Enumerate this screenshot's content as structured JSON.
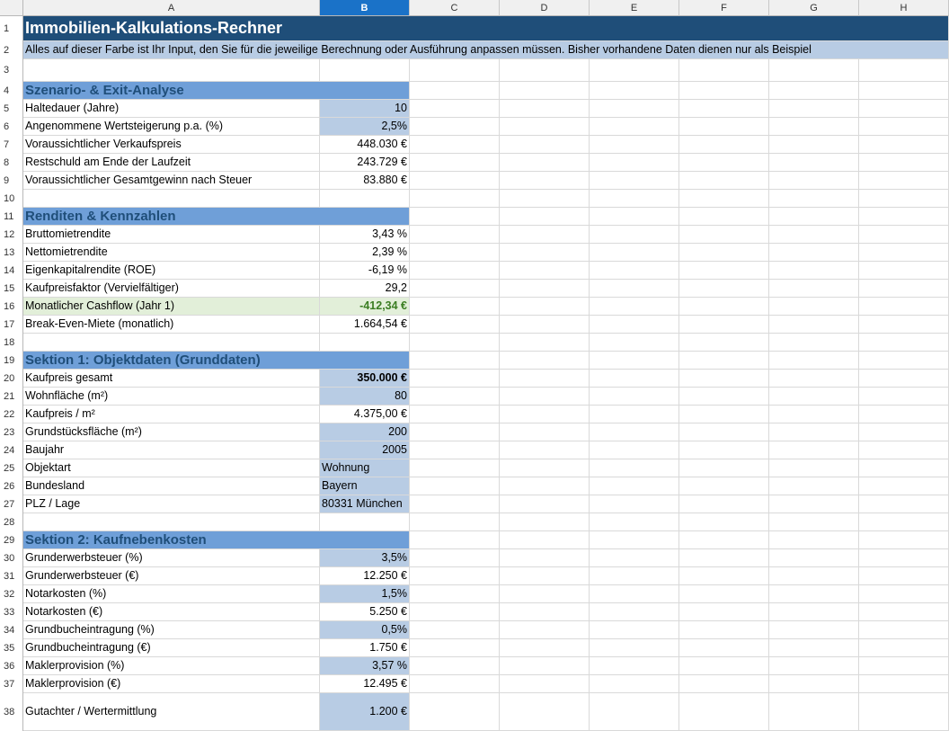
{
  "columns": [
    "A",
    "B",
    "C",
    "D",
    "E",
    "F",
    "G",
    "H"
  ],
  "selected_column": "B",
  "row_numbers": [
    "1",
    "2",
    "3",
    "4",
    "5",
    "6",
    "7",
    "8",
    "9",
    "10",
    "11",
    "12",
    "13",
    "14",
    "15",
    "16",
    "17",
    "18",
    "19",
    "20",
    "21",
    "22",
    "23",
    "24",
    "25",
    "26",
    "27",
    "28",
    "29",
    "30",
    "31",
    "32",
    "33",
    "34",
    "35",
    "36",
    "37",
    "38"
  ],
  "title": "Immobilien-Kalkulations-Rechner",
  "subtitle": "Alles auf dieser Farbe ist Ihr Input, den Sie für die jeweilige Berechnung oder Ausführung anpassen müssen. Bisher vorhandene Daten dienen nur als Beispiel",
  "sections": {
    "s1": "Szenario- & Exit-Analyse",
    "s2": "Renditen & Kennzahlen",
    "s3": "Sektion 1: Objektdaten (Grunddaten)",
    "s4": "Sektion 2: Kaufnebenkosten"
  },
  "rows": {
    "r5": {
      "label": "Haltedauer (Jahre)",
      "value": "10"
    },
    "r6": {
      "label": "Angenommene Wertsteigerung p.a. (%)",
      "value": "2,5%"
    },
    "r7": {
      "label": "Voraussichtlicher Verkaufspreis",
      "value": "448.030 €"
    },
    "r8": {
      "label": "Restschuld am Ende der Laufzeit",
      "value": "243.729 €"
    },
    "r9": {
      "label": "Voraussichtlicher Gesamtgewinn nach Steuer",
      "value": "83.880 €"
    },
    "r12": {
      "label": "Bruttomietrendite",
      "value": "3,43 %"
    },
    "r13": {
      "label": "Nettomietrendite",
      "value": "2,39 %"
    },
    "r14": {
      "label": "Eigenkapitalrendite (ROE)",
      "value": "-6,19 %"
    },
    "r15": {
      "label": "Kaufpreisfaktor (Vervielfältiger)",
      "value": "29,2"
    },
    "r16": {
      "label": "Monatlicher Cashflow (Jahr 1)",
      "value": "-412,34 €"
    },
    "r17": {
      "label": "Break-Even-Miete (monatlich)",
      "value": "1.664,54 €"
    },
    "r20": {
      "label": "Kaufpreis gesamt",
      "value": "350.000 €"
    },
    "r21": {
      "label": "Wohnfläche (m²)",
      "value": "80"
    },
    "r22": {
      "label": "Kaufpreis / m²",
      "value": "4.375,00 €"
    },
    "r23": {
      "label": "Grundstücksfläche (m²)",
      "value": "200"
    },
    "r24": {
      "label": "Baujahr",
      "value": "2005"
    },
    "r25": {
      "label": "Objektart",
      "value": "Wohnung"
    },
    "r26": {
      "label": "Bundesland",
      "value": "Bayern"
    },
    "r27": {
      "label": "PLZ / Lage",
      "value": "80331 München"
    },
    "r30": {
      "label": "Grunderwerbsteuer (%)",
      "value": "3,5%"
    },
    "r31": {
      "label": "Grunderwerbsteuer (€)",
      "value": "12.250 €"
    },
    "r32": {
      "label": "Notarkosten (%)",
      "value": "1,5%"
    },
    "r33": {
      "label": "Notarkosten (€)",
      "value": "5.250 €"
    },
    "r34": {
      "label": "Grundbucheintragung (%)",
      "value": "0,5%"
    },
    "r35": {
      "label": "Grundbucheintragung (€)",
      "value": "1.750 €"
    },
    "r36": {
      "label": "Maklerprovision (%)",
      "value": "3,57 %"
    },
    "r37": {
      "label": "Maklerprovision (€)",
      "value": "12.495 €"
    },
    "r38": {
      "label": "Gutachter / Wertermittlung",
      "value": "1.200 €"
    }
  },
  "colors": {
    "title_bg": "#1f4e79",
    "input_bg": "#b8cce4",
    "section_bg": "#6f9fd8",
    "highlight_bg": "#e2efd9"
  }
}
